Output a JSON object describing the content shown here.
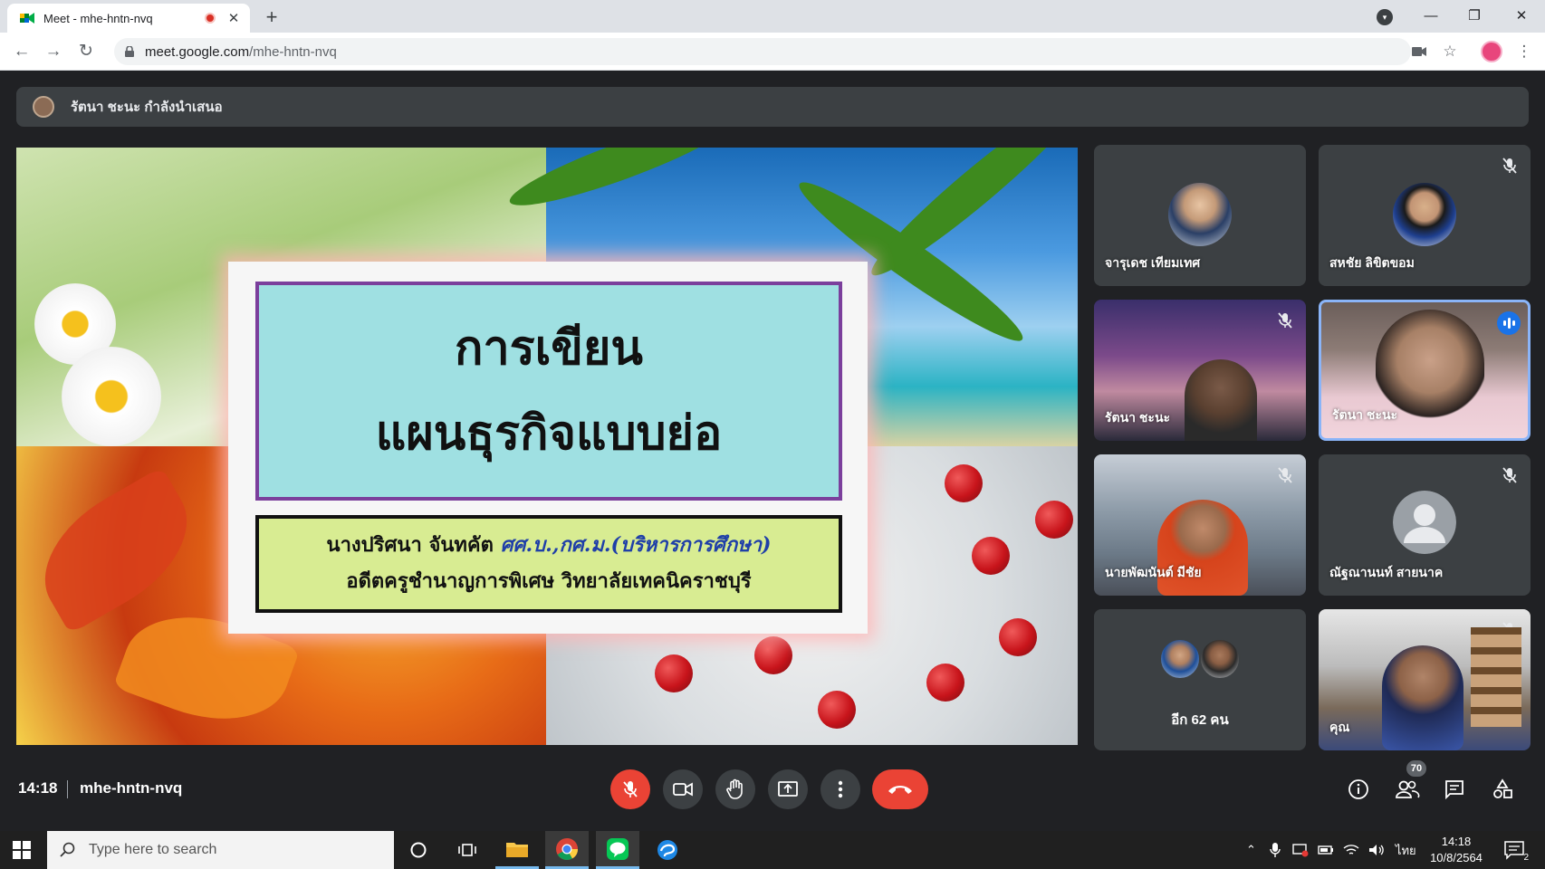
{
  "browser": {
    "tab_title": "Meet - mhe-hntn-nvq",
    "url_host": "meet.google.com",
    "url_path": "/mhe-hntn-nvq",
    "new_tab_label": "+",
    "close_tab_label": "✕",
    "win_minimize": "—",
    "win_restore": "❐",
    "win_close": "✕"
  },
  "meet": {
    "presenter_text": "รัตนา ชะนะ กำลังนำเสนอ",
    "time": "14:18",
    "meeting_code": "mhe-hntn-nvq",
    "people_count": "70",
    "slide": {
      "title_line1": "การเขียน",
      "title_line2": "แผนธุรกิจแบบย่อ",
      "author_name": "นางปริศนา  จันทคัต",
      "author_degree": "ศศ.บ.,กศ.ม.(บริหารการศึกษา)",
      "author_position": "อดีตครูชำนาญการพิเศษ  วิทยาลัยเทคนิคราชบุรี"
    },
    "participants": [
      {
        "name": "จารุเดช เทียมเทศ",
        "muted": false
      },
      {
        "name": "สหชัย ลิขิตขอม",
        "muted": true
      },
      {
        "name": "รัตนา ชะนะ",
        "muted": true
      },
      {
        "name": "รัตนา ชะนะ",
        "muted": false,
        "speaking": true
      },
      {
        "name": "นายพัฒนันต์ มีชัย",
        "muted": true
      },
      {
        "name": "ณัฐณานนท์ สายนาค",
        "muted": true
      },
      {
        "name": "คุณ",
        "muted": true
      }
    ],
    "more_participants": "อีก 62 คน"
  },
  "taskbar": {
    "search_placeholder": "Type here to search",
    "lang": "ไทย",
    "clock_time": "14:18",
    "clock_date": "10/8/2564",
    "notification_count": "2"
  },
  "colors": {
    "meet_bg": "#202124",
    "tile_bg": "#3c4043",
    "end_call": "#ea4335",
    "active_border": "#8ab4f8"
  }
}
